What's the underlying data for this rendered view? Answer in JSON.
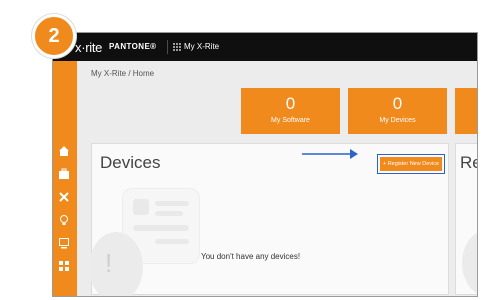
{
  "step_badge": "2",
  "header": {
    "logo_text": "x·rite",
    "pantone_text": "PANTONE®",
    "app_switcher_label": "My X-Rite"
  },
  "breadcrumb": "My X-Rite / Home",
  "tiles": [
    {
      "count": "0",
      "label": "My Software"
    },
    {
      "count": "0",
      "label": "My Devices"
    }
  ],
  "devices_card": {
    "title": "Devices",
    "register_button_label": "+ Register New Device",
    "empty_message": "You don't have any devices!"
  },
  "side_card": {
    "title": "Re"
  },
  "sidebar": {
    "icons": [
      "home-icon",
      "briefcase-icon",
      "tools-icon",
      "lightbulb-icon",
      "monitor-icon",
      "apps-icon"
    ]
  },
  "colors": {
    "accent": "#f08a1c",
    "topbar": "#0f0f0f",
    "highlight_border": "#2a63c9"
  }
}
